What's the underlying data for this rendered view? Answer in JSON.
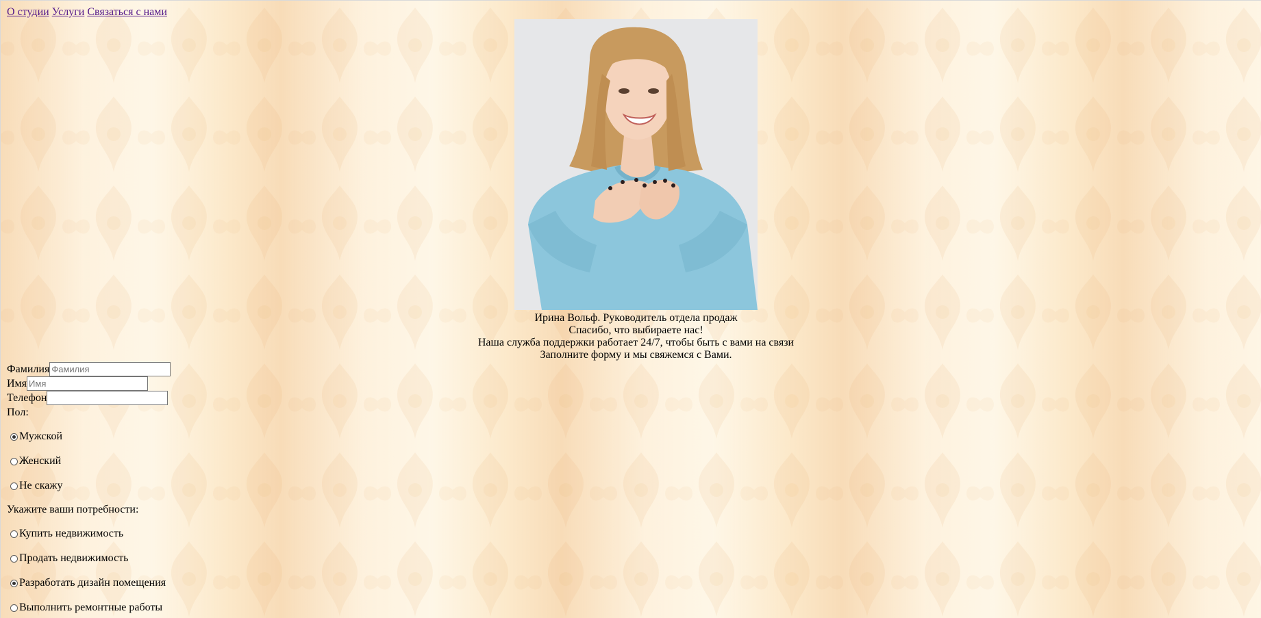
{
  "nav": {
    "about": "О студии",
    "services": "Услуги",
    "contact": "Связаться с нами"
  },
  "caption": {
    "line1": "Ирина Вольф. Руководитель отдела продаж",
    "line2": "Спасибо, что выбираете нас!",
    "line3": "Наша служба поддержки работает 24/7, чтобы быть с вами на связи",
    "line4": "Заполните форму и мы свяжемся с Вами."
  },
  "form": {
    "surname_label": "Фамилия",
    "surname_placeholder": "Фамилия",
    "name_label": "Имя",
    "name_placeholder": "Имя",
    "phone_label": "Телефон",
    "phone_value": "",
    "gender_label": "Пол:",
    "gender_options": [
      {
        "label": "Мужской",
        "checked": true
      },
      {
        "label": "Женский",
        "checked": false
      },
      {
        "label": "Не скажу",
        "checked": false
      }
    ],
    "needs_label": "Укажите ваши потребности:",
    "needs_options": [
      {
        "label": "Купить недвижимость",
        "checked": false
      },
      {
        "label": "Продать недвижимость",
        "checked": false
      },
      {
        "label": "Разработать дизайн помещения",
        "checked": true
      },
      {
        "label": "Выполнить ремонтные работы",
        "checked": false
      }
    ]
  },
  "colors": {
    "link": "#551a8b",
    "sweater": "#8cc6dc",
    "photo_background": "#e6e7e9",
    "hair": "#c89a5e"
  }
}
